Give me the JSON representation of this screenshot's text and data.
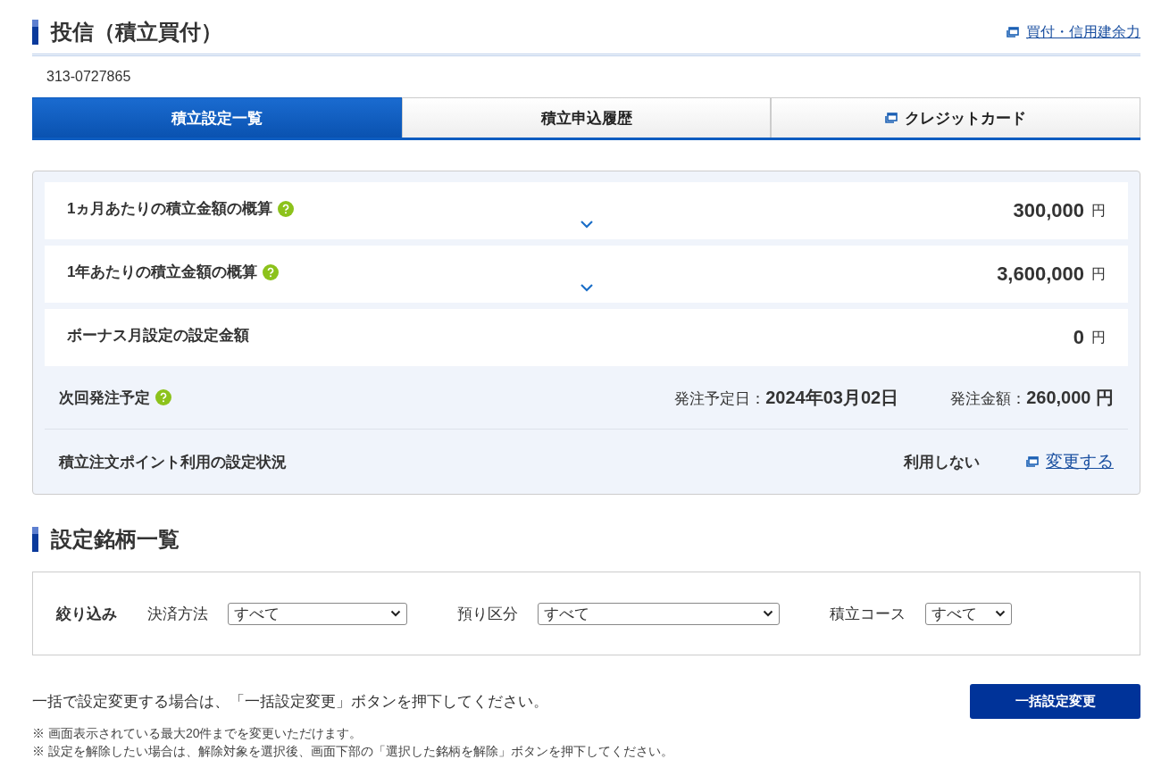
{
  "page_title": "投信（積立買付）",
  "header_link": {
    "label": "買付・信用建余力",
    "external": true
  },
  "account_number": "313-0727865",
  "tabs": [
    {
      "label": "積立設定一覧",
      "selected": true,
      "external": false
    },
    {
      "label": "積立申込履歴",
      "selected": false,
      "external": false
    },
    {
      "label": "クレジットカード",
      "selected": false,
      "external": true
    }
  ],
  "summary_rows": [
    {
      "label": "1ヵ月あたりの積立金額の概算",
      "help": true,
      "expandable": true,
      "value": "300,000",
      "unit": "円"
    },
    {
      "label": "1年あたりの積立金額の概算",
      "help": true,
      "expandable": true,
      "value": "3,600,000",
      "unit": "円"
    },
    {
      "label": "ボーナス月設定の設定金額",
      "help": false,
      "expandable": false,
      "value": "0",
      "unit": "円"
    }
  ],
  "next_order": {
    "label": "次回発注予定",
    "help": true,
    "date_label": "発注予定日：",
    "date": "2024年03月02日",
    "amount_label": "発注金額：",
    "amount": "260,000 円"
  },
  "point_setting": {
    "label": "積立注文ポイント利用の設定状況",
    "status": "利用しない",
    "link": {
      "label": "変更する",
      "external": true
    }
  },
  "section_title": "設定銘柄一覧",
  "filter": {
    "label": "絞り込み",
    "selects": [
      {
        "label": "決済方法",
        "value": "すべて"
      },
      {
        "label": "預り区分",
        "value": "すべて"
      },
      {
        "label": "積立コース",
        "value": "すべて"
      }
    ]
  },
  "bulk_message": "一括で設定変更する場合は、「一括設定変更」ボタンを押下してください。",
  "bulk_button": "一括設定変更",
  "notes": [
    "※ 画面表示されている最大20件までを変更いただけます。",
    "※ 設定を解除したい場合は、解除対象を選択後、画面下部の「選択した銘柄を解除」ボタンを押下してください。"
  ]
}
